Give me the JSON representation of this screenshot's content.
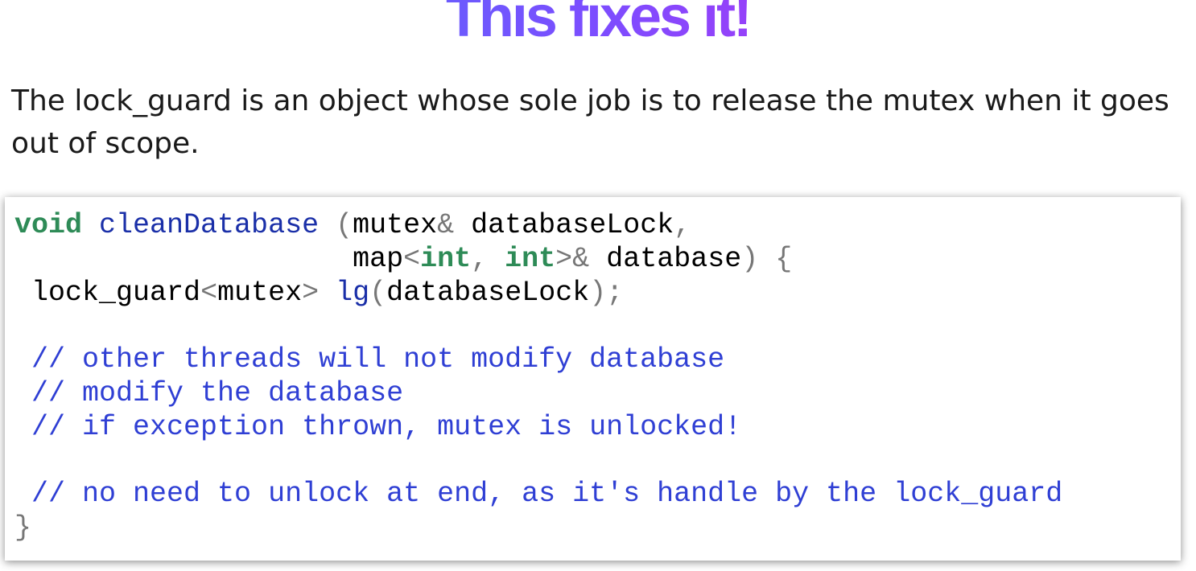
{
  "slide": {
    "title": "This fixes it!",
    "intro": "The lock_guard is an object whose sole job is to release the mutex when it goes out of scope."
  },
  "code": {
    "l1_kw": "void",
    "l1_fn": "cleanDatabase",
    "l1_p1": "(",
    "l1_t1": "mutex",
    "l1_p2": "&",
    "l1_t2": "databaseLock",
    "l1_p3": ",",
    "l2_indent": "                    ",
    "l2_t1": "map",
    "l2_p1": "<",
    "l2_kw1": "int",
    "l2_p2": ", ",
    "l2_kw2": "int",
    "l2_p3": ">&",
    "l2_t2": "database",
    "l2_p4": ")",
    "l2_p5": "{",
    "l3_t1": "lock_guard",
    "l3_p1": "<",
    "l3_t2": "mutex",
    "l3_p2": ">",
    "l3_fn": "lg",
    "l3_p3": "(",
    "l3_t3": "databaseLock",
    "l3_p4": ");",
    "c1": "// other threads will not modify database",
    "c2": "// modify the database",
    "c3": "// if exception thrown, mutex is unlocked!",
    "c4": "// no need to unlock at end, as it's handle by the lock_guard",
    "close": "}"
  }
}
